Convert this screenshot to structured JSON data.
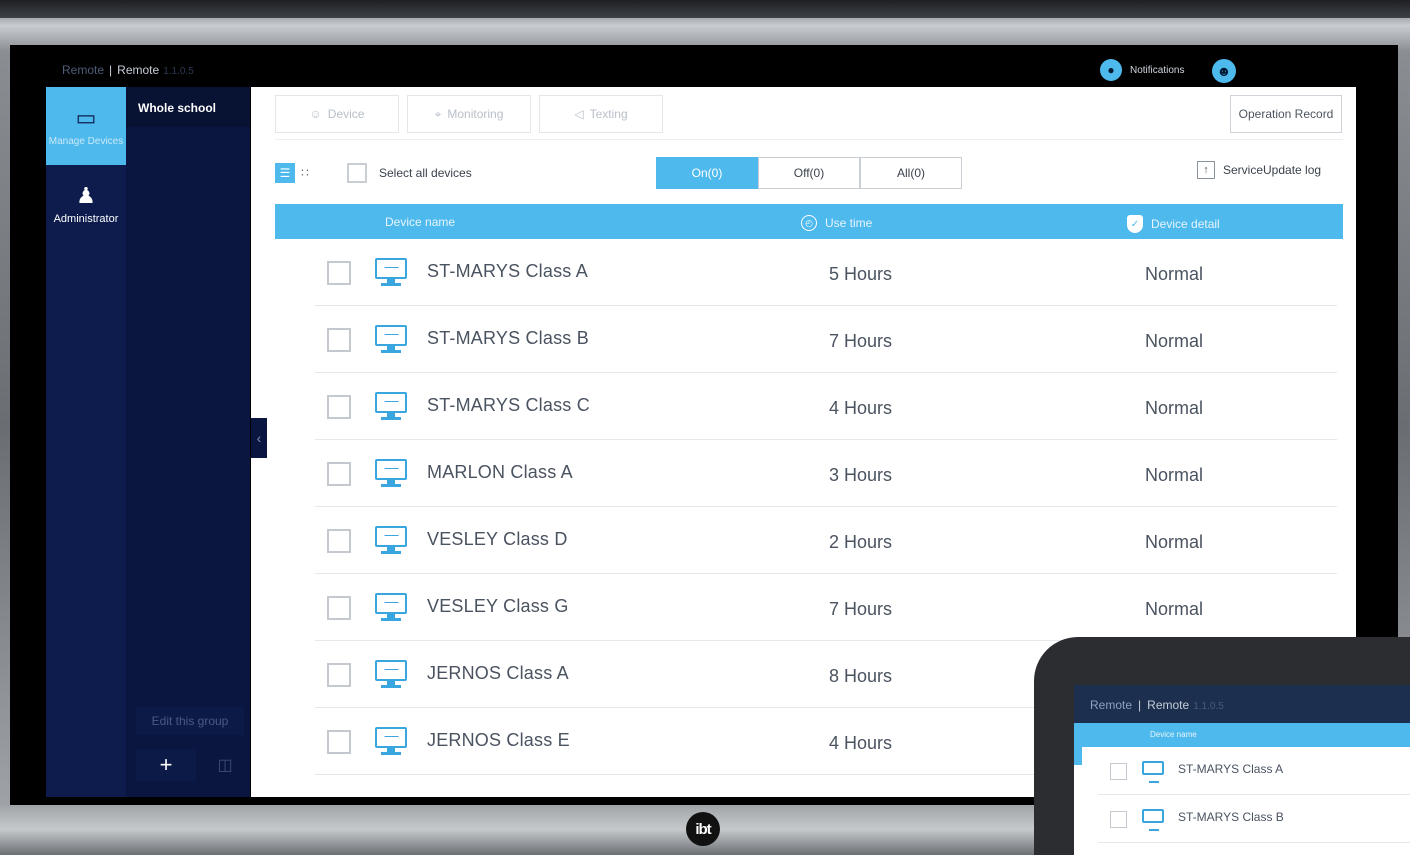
{
  "topbar": {
    "brand_dim": "Remote",
    "brand_sep": "|",
    "brand_name": "Remote",
    "brand_version": "1.1.0.5",
    "notifications_label": "Notifications"
  },
  "leftnav": {
    "items": [
      {
        "label": "Manage Devices",
        "icon": "laptop-icon",
        "active": true
      },
      {
        "label": "Administrator",
        "icon": "admin-user-icon",
        "active": false
      }
    ]
  },
  "group_panel": {
    "title": "Whole school",
    "edit_label": "Edit this group",
    "add_label": "+"
  },
  "tabs": [
    {
      "label": "Device",
      "icon": "device-icon"
    },
    {
      "label": "Monitoring",
      "icon": "monitoring-icon"
    },
    {
      "label": "Texting",
      "icon": "speaker-icon"
    }
  ],
  "operation_record_label": "Operation Record",
  "select_all_label": "Select all devices",
  "filters": [
    {
      "label": "On(0)",
      "active": true
    },
    {
      "label": "Off(0)",
      "active": false
    },
    {
      "label": "All(0)",
      "active": false
    }
  ],
  "service_update_label": "ServiceUpdate log",
  "table": {
    "headers": {
      "device_name": "Device name",
      "use_time": "Use time",
      "device_detail": "Device detail"
    },
    "rows": [
      {
        "name": "ST-MARYS Class A",
        "use_time": "5 Hours",
        "detail": "Normal"
      },
      {
        "name": "ST-MARYS Class B",
        "use_time": "7 Hours",
        "detail": "Normal"
      },
      {
        "name": "ST-MARYS Class C",
        "use_time": "4 Hours",
        "detail": "Normal"
      },
      {
        "name": "MARLON Class A",
        "use_time": "3 Hours",
        "detail": "Normal"
      },
      {
        "name": "VESLEY Class D",
        "use_time": "2 Hours",
        "detail": "Normal"
      },
      {
        "name": "VESLEY Class G",
        "use_time": "7 Hours",
        "detail": "Normal"
      },
      {
        "name": "JERNOS Class A",
        "use_time": "8 Hours",
        "detail": ""
      },
      {
        "name": "JERNOS Class E",
        "use_time": "4 Hours",
        "detail": ""
      }
    ]
  },
  "logo_text": "ibt",
  "tablet": {
    "brand_dim": "Remote",
    "brand_sep": "|",
    "brand_name": "Remote",
    "brand_version": "1.1.0.5",
    "header_label": "Device name",
    "rows": [
      {
        "name": "ST-MARYS Class A"
      },
      {
        "name": "ST-MARYS Class B"
      }
    ]
  },
  "colors": {
    "accent": "#4eb9ec",
    "nav_bg": "#0d1c4d",
    "text": "#4a5360"
  }
}
